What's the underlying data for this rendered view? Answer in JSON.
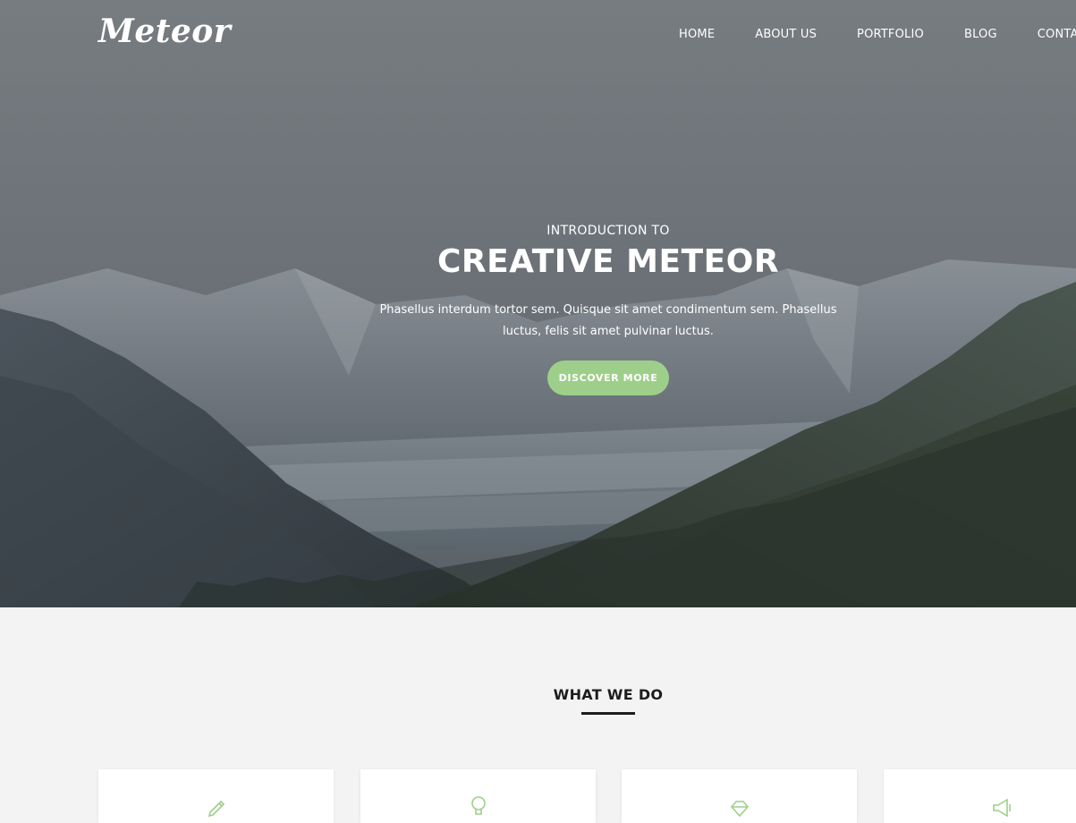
{
  "header": {
    "logo": "Meteor",
    "nav": [
      "HOME",
      "ABOUT US",
      "PORTFOLIO",
      "BLOG",
      "CONTACT"
    ]
  },
  "hero": {
    "intro": "INTRODUCTION TO",
    "headline": "CREATIVE METEOR",
    "tagline": "Phasellus interdum tortor sem. Quisque sit amet condimentum sem. Phasellus luctus, felis sit amet pulvinar luctus.",
    "cta_label": "DISCOVER MORE"
  },
  "services": {
    "title": "WHAT WE DO",
    "cards": [
      {
        "icon": "pencil-icon"
      },
      {
        "icon": "lightbulb-icon"
      },
      {
        "icon": "diamond-icon"
      },
      {
        "icon": "megaphone-icon"
      }
    ]
  },
  "colors": {
    "accent": "#9ecf8a",
    "heading": "#1c1c1c",
    "section_bg": "#f3f3f3"
  }
}
